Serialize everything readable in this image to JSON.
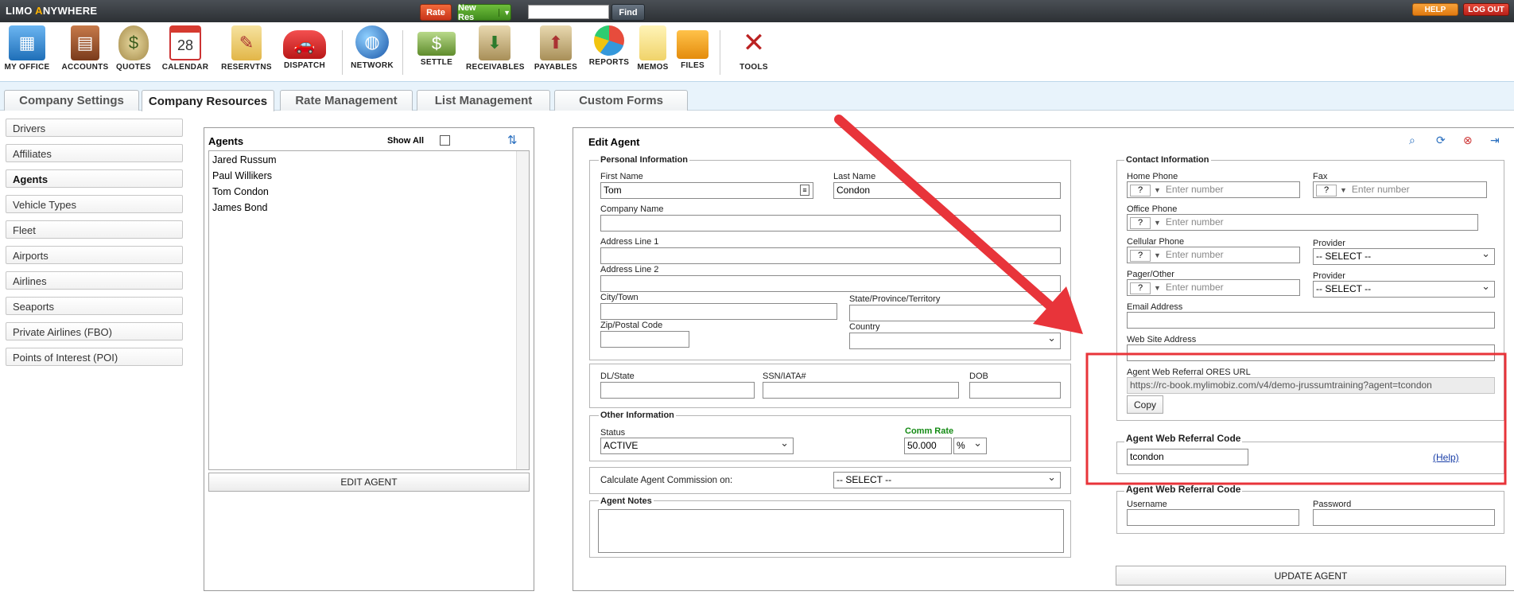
{
  "topbar": {
    "logo_a": "LIMO ",
    "logo_b": "A",
    "logo_c": "NYWHERE",
    "rate_label": "Rate",
    "newres_label": "New Res",
    "search_value": "",
    "find_label": "Find",
    "help_label": "HELP",
    "logout_label": "LOG OUT"
  },
  "nav": {
    "my_office": "MY OFFICE",
    "accounts": "ACCOUNTS",
    "quotes": "QUOTES",
    "calendar": "CALENDAR",
    "calendar_day": "28",
    "reservtns": "RESERVTNS",
    "dispatch": "DISPATCH",
    "network": "NETWORK",
    "settle": "SETTLE",
    "receivables": "RECEIVABLES",
    "payables": "PAYABLES",
    "reports": "REPORTS",
    "memos": "MEMOS",
    "files": "FILES",
    "tools": "TOOLS"
  },
  "tabs": {
    "company_settings": "Company Settings",
    "company_resources": "Company Resources",
    "rate_management": "Rate Management",
    "list_management": "List Management",
    "custom_forms": "Custom Forms"
  },
  "sidebar": {
    "drivers": "Drivers",
    "affiliates": "Affiliates",
    "agents": "Agents",
    "vehicle_types": "Vehicle Types",
    "fleet": "Fleet",
    "airports": "Airports",
    "airlines": "Airlines",
    "seaports": "Seaports",
    "private_airlines": "Private Airlines (FBO)",
    "poi": "Points of Interest (POI)"
  },
  "agents_panel": {
    "title": "Agents",
    "show_all": "Show All",
    "list": [
      "Jared Russum",
      "Paul Willikers",
      "Tom Condon",
      "James Bond"
    ],
    "edit_button": "EDIT AGENT"
  },
  "edit_agent": {
    "title": "Edit Agent",
    "personal_info": "Personal Information",
    "first_name_label": "First Name",
    "first_name": "Tom",
    "last_name_label": "Last Name",
    "last_name": "Condon",
    "company_name_label": "Company Name",
    "address1_label": "Address Line 1",
    "address2_label": "Address Line 2",
    "city_label": "City/Town",
    "state_label": "State/Province/Territory",
    "zip_label": "Zip/Postal Code",
    "country_label": "Country",
    "dl_label": "DL/State",
    "ssn_label": "SSN/IATA#",
    "dob_label": "DOB",
    "other_info": "Other Information",
    "status_label": "Status",
    "status": "ACTIVE",
    "comm_rate_label": "Comm Rate",
    "comm_rate": "50.000",
    "comm_unit": "%",
    "calc_label": "Calculate Agent Commission on:",
    "calc_value": "-- SELECT --",
    "notes_label": "Agent Notes",
    "contact_info": "Contact Information",
    "home_phone_label": "Home Phone",
    "fax_label": "Fax",
    "office_phone_label": "Office Phone",
    "cellular_label": "Cellular Phone",
    "provider_label": "Provider",
    "pager_label": "Pager/Other",
    "phone_code": "?",
    "phone_placeholder": "Enter number",
    "provider_value": "-- SELECT --",
    "email_label": "Email Address",
    "website_label": "Web Site Address",
    "referral_url_label": "Agent Web Referral ORES URL",
    "referral_url": "https://rc-book.mylimobiz.com/v4/demo-jrussumtraining?agent=tcondon",
    "copy_button": "Copy",
    "referral_code_title": "Agent Web Referral Code",
    "referral_code": "tcondon",
    "help_link": "(Help)",
    "login_title": "Agent Web Referral Code",
    "username_label": "Username",
    "password_label": "Password",
    "update_button": "UPDATE AGENT"
  },
  "colors": {
    "annotation_red": "#e8343a",
    "comm_rate_green": "#138a13"
  }
}
